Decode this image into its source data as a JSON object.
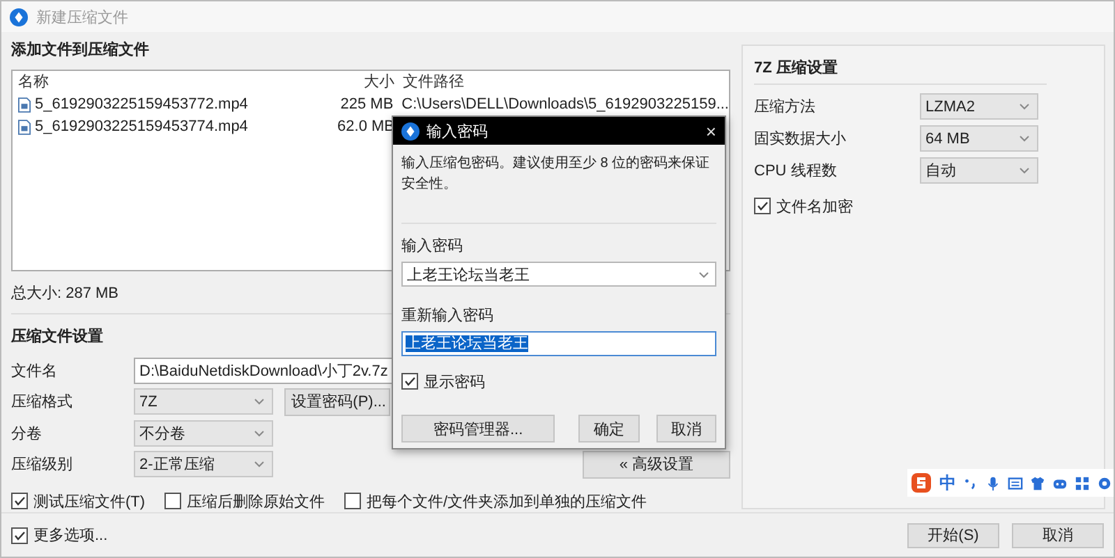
{
  "window": {
    "title": "新建压缩文件"
  },
  "files_section": {
    "title": "添加文件到压缩文件",
    "columns": [
      "名称",
      "大小",
      "文件路径"
    ],
    "rows": [
      {
        "name": "5_6192903225159453772.mp4",
        "size": "225 MB",
        "path": "C:\\Users\\DELL\\Downloads\\5_6192903225159..."
      },
      {
        "name": "5_6192903225159453774.mp4",
        "size": "62.0 MB"
      }
    ],
    "total": "总大小: 287 MB"
  },
  "settings": {
    "title": "压缩文件设置",
    "fields": [
      {
        "kind": "input",
        "label": "文件名",
        "value": "D:\\BaiduNetdiskDownload\\小丁2v.7z"
      },
      {
        "kind": "select",
        "label": "压缩格式",
        "value": "7Z",
        "button": "设置密码(P)..."
      },
      {
        "kind": "select",
        "label": "分卷",
        "value": "不分卷"
      },
      {
        "kind": "select",
        "label": "压缩级别",
        "value": "2-正常压缩",
        "button": "« 高级设置"
      }
    ],
    "options": [
      {
        "label": "测试压缩文件(T)",
        "checked": true
      },
      {
        "label": "压缩后删除原始文件",
        "checked": false
      },
      {
        "label": "把每个文件/文件夹添加到单独的压缩文件",
        "checked": false
      }
    ]
  },
  "sevenz": {
    "title": "7Z 压缩设置",
    "fields": [
      {
        "label": "压缩方法",
        "value": "LZMA2"
      },
      {
        "label": "固实数据大小",
        "value": "64 MB"
      },
      {
        "label": "CPU 线程数",
        "value": "自动"
      }
    ],
    "encrypt_names": {
      "label": "文件名加密",
      "checked": true
    }
  },
  "more_options": {
    "label": "更多选项...",
    "checked": true
  },
  "buttons": [
    "开始(S)",
    "取消"
  ],
  "dialog": {
    "title": "输入密码",
    "close": "×",
    "description": "输入压缩包密码。建议使用至少 8 位的密码来保证安全性。",
    "password_label": "输入密码",
    "password": "上老王论坛当老王",
    "repeat_label": "重新输入密码",
    "repeat": "上老王论坛当老王",
    "repeat_text_selected": true,
    "show_password": {
      "label": "显示密码",
      "checked": true
    },
    "buttons": [
      "密码管理器...",
      "确定",
      "取消"
    ]
  },
  "ime_toolbar": {
    "mode": "中"
  }
}
